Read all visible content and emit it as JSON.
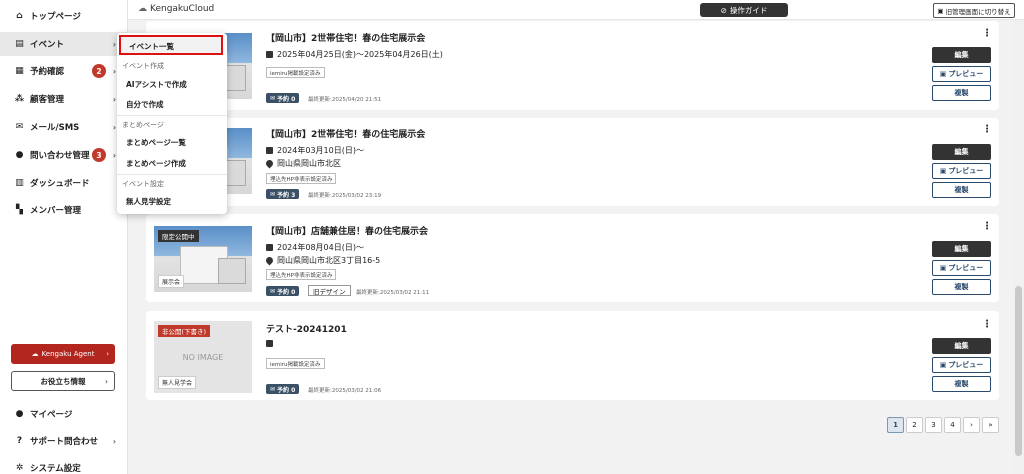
{
  "sidebar": {
    "items": [
      {
        "icon": "home-icon",
        "label": "トップページ"
      },
      {
        "icon": "document-icon",
        "label": "イベント"
      },
      {
        "icon": "calendar-icon",
        "label": "予約確認",
        "badge": "2"
      },
      {
        "icon": "customers-icon",
        "label": "顧客管理"
      },
      {
        "icon": "mail-icon",
        "label": "メール/SMS"
      },
      {
        "icon": "chat-icon",
        "label": "問い合わせ管理",
        "badge": "3"
      },
      {
        "icon": "dashboard-icon",
        "label": "ダッシュボード"
      },
      {
        "icon": "members-icon",
        "label": "メンバー管理"
      }
    ],
    "agent_button": "Kengaku Agent",
    "info_button": "お役立ち情報",
    "bottom": [
      {
        "icon": "person-icon",
        "label": "マイページ"
      },
      {
        "icon": "help-icon",
        "label": "サポート問合わせ"
      },
      {
        "icon": "gear-icon",
        "label": "システム設定"
      }
    ]
  },
  "topbar": {
    "logo": "KengakuCloud",
    "guide_button": "操作ガイド",
    "old_button": "旧管理画面に切り替え"
  },
  "dropdown": {
    "selected": "イベント一覧",
    "heading_create": "イベント作成",
    "ai_create": "AIアシストで作成",
    "self_create": "自分で作成",
    "heading_summary": "まとめページ",
    "summary_list": "まとめページ一覧",
    "summary_create": "まとめページ作成",
    "heading_settings": "イベント設定",
    "tour_settings": "無人見学設定"
  },
  "events": [
    {
      "title": "【岡山市】2世帯住宅！春の住宅展示会",
      "date": "2025年04月25日(金)〜2025年04月26日(土)",
      "location": "",
      "chip": "iemiru掲載設定済み",
      "reservations": "予約 0",
      "old_design": "",
      "updated": "最終更新:2025/04/20 21:51",
      "image": "photo",
      "tag_top": "",
      "tag_bottom": ""
    },
    {
      "title": "【岡山市】2世帯住宅！春の住宅展示会",
      "date": "2024年03月10日(日)〜",
      "location": "岡山県岡山市北区",
      "chip": "埋込先HP非表示設定済み",
      "reservations": "予約 3",
      "old_design": "",
      "updated": "最終更新:2025/03/02 23:19",
      "image": "photo",
      "tag_top": "",
      "tag_bottom": ""
    },
    {
      "title": "【岡山市】店舗兼住居！春の住宅展示会",
      "date": "2024年08月04日(日)〜",
      "location": "岡山県岡山市北区3丁目16-5",
      "chip": "埋込先HP非表示設定済み",
      "reservations": "予約 0",
      "old_design": "旧デザイン",
      "updated": "最終更新:2025/03/02 21:11",
      "image": "photo",
      "tag_top": "限定公開中",
      "tag_bottom": "展示会"
    },
    {
      "title": "テスト-20241201",
      "date": "",
      "location": "",
      "chip": "iemiru掲載設定済み",
      "reservations": "予約 0",
      "old_design": "",
      "updated": "最終更新:2025/03/02 21:06",
      "image": "noimage",
      "noimage_text": "NO IMAGE",
      "tag_top": "非公開(下書き)",
      "tag_bottom": "無人見学会"
    }
  ],
  "card_actions": {
    "edit": "編集",
    "preview": "プレビュー",
    "copy": "複製",
    "menu": "⋮"
  },
  "pagination": {
    "pages": [
      "1",
      "2",
      "3",
      "4"
    ],
    "current": "1",
    "next": "›",
    "last": "»"
  },
  "colors": {
    "accent_red": "#c0392b",
    "dark_button": "#333333",
    "navy": "#2a4a6b"
  }
}
